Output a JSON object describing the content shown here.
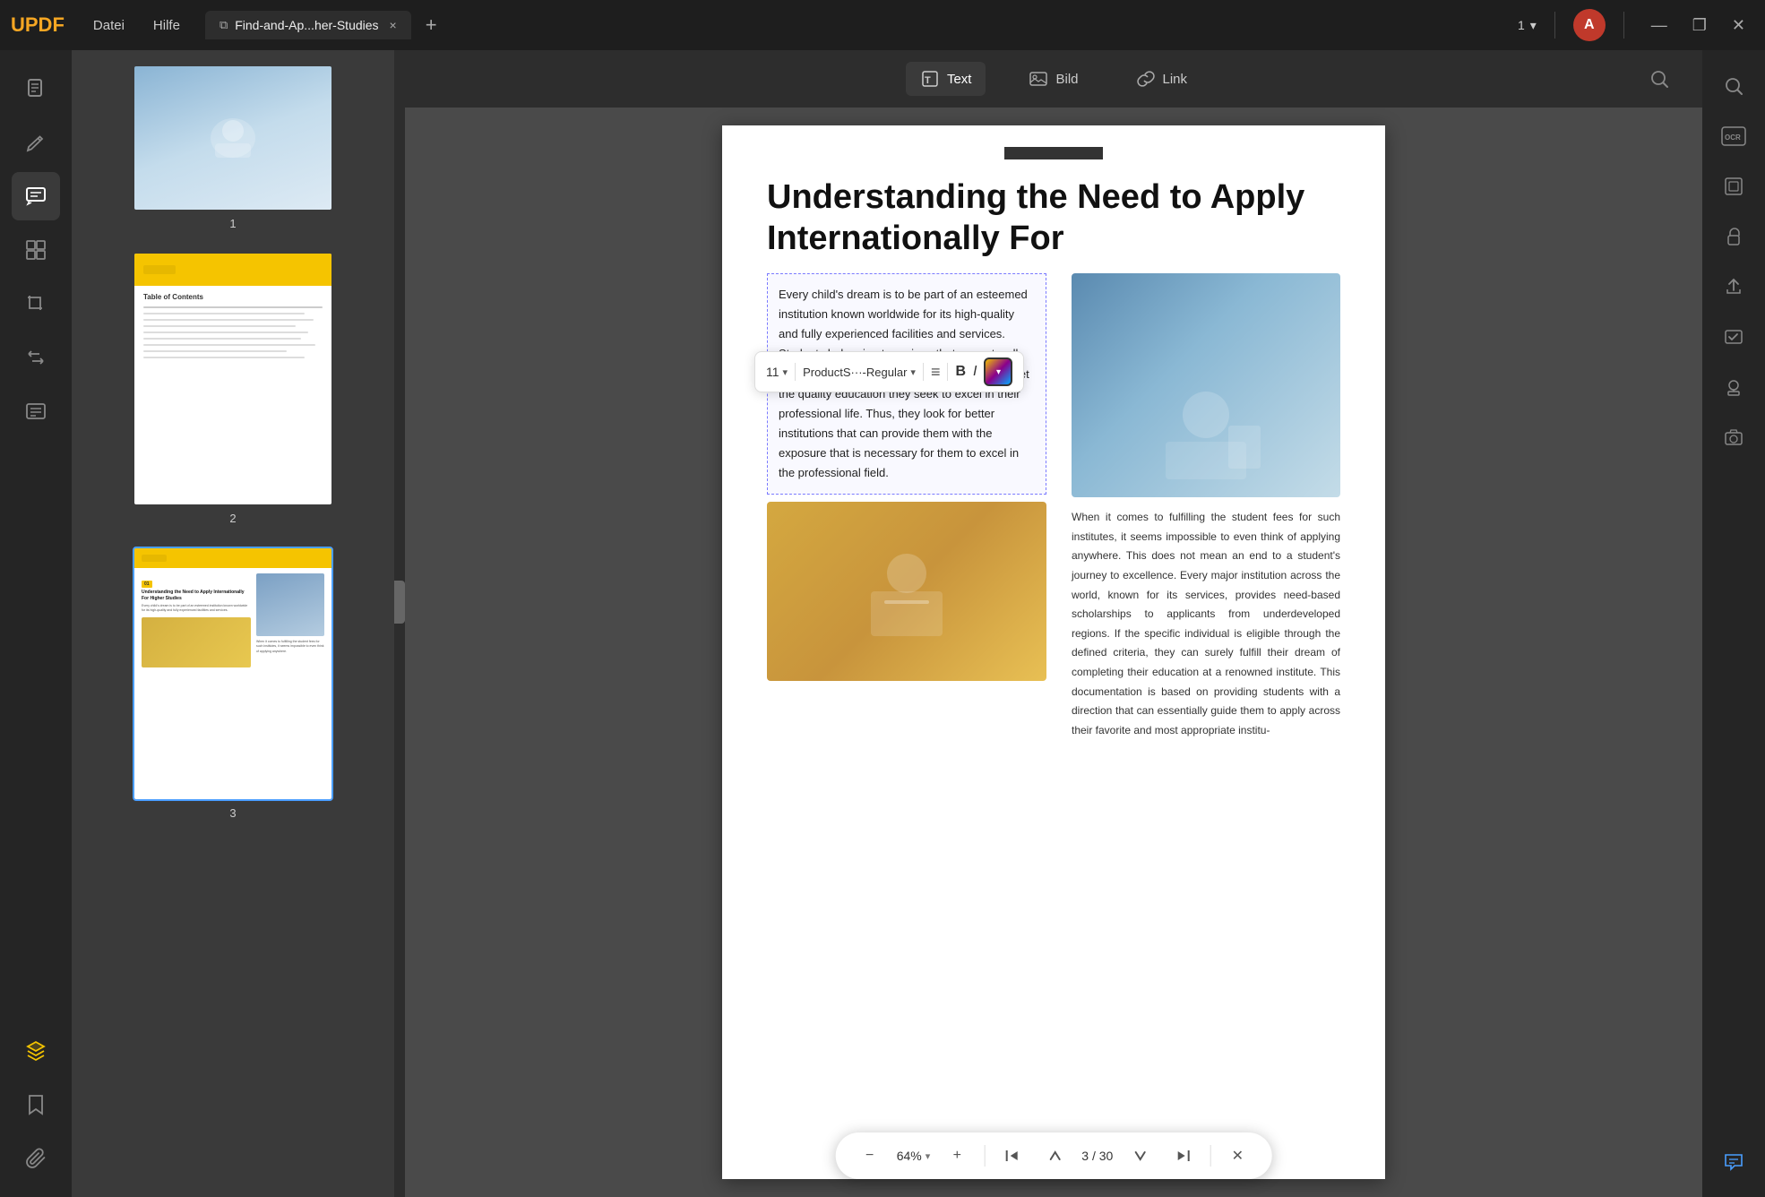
{
  "app": {
    "logo": "UPDF",
    "menu": {
      "datei": "Datei",
      "hilfe": "Hilfe"
    }
  },
  "titlebar": {
    "tab": {
      "icon": "📄",
      "label": "Find-and-Ap...her-Studies",
      "close": "×"
    },
    "add_tab": "+",
    "page_nav": {
      "current": "1",
      "chevron": "▾"
    },
    "avatar_letter": "A",
    "win_buttons": {
      "minimize": "—",
      "maximize": "❐",
      "close": "✕"
    }
  },
  "sidebar": {
    "icons": [
      {
        "name": "document-icon",
        "symbol": "📋",
        "active": false
      },
      {
        "name": "edit-icon",
        "symbol": "✏️",
        "active": false
      },
      {
        "name": "comment-icon",
        "symbol": "🗂",
        "active": true
      },
      {
        "name": "organize-icon",
        "symbol": "📑",
        "active": false
      },
      {
        "name": "crop-icon",
        "symbol": "⊞",
        "active": false
      },
      {
        "name": "convert-icon",
        "symbol": "🔄",
        "active": false
      },
      {
        "name": "ocr-icon",
        "symbol": "≡",
        "active": false
      }
    ],
    "bottom": [
      {
        "name": "layers-icon",
        "symbol": "◈"
      },
      {
        "name": "bookmark-icon",
        "symbol": "🔖"
      },
      {
        "name": "paperclip-icon",
        "symbol": "📎"
      }
    ]
  },
  "thumbnails": [
    {
      "id": 1,
      "label": "1",
      "selected": false
    },
    {
      "id": 2,
      "label": "2",
      "selected": false,
      "title": "Table of Contents"
    },
    {
      "id": 3,
      "label": "3",
      "selected": true
    }
  ],
  "toolbar": {
    "text_btn": "Text",
    "bild_btn": "Bild",
    "link_btn": "Link"
  },
  "format_toolbar": {
    "size": "11",
    "size_arrow": "▾",
    "font": "ProductS···-Regular",
    "font_arrow": "▾",
    "align_icon": "≡",
    "bold": "B",
    "italic": "I"
  },
  "document": {
    "title": "Understanding the Need to Apply Internationally For",
    "paragraph1": "Every child's dream is to be part of an esteemed institution known worldwide for its high-quality and fully experienced facilities and services. Students belonging to regions that are not well-esteemed and underdeveloped usually fail to get the quality education they seek to excel in their professional life. Thus, they look for better institutions that can provide them with the exposure that is necessary for them to excel in the professional field.",
    "paragraph2": "When it comes to fulfilling the student fees for such institutes, it seems impossible to even think of applying anywhere. This does not mean an end to a student's journey to excellence. Every major institution across the world, known for its services, provides need-based scholarships to applicants from underdeveloped regions. If the specific individual is eligible through the defined criteria, they can surely fulfill their dream of completing their education at a renowned institute. This documentation is based on providing students with a direction that can essentially guide them to apply across their favorite and most appropriate institu-"
  },
  "bottom_bar": {
    "zoom_out": "−",
    "zoom_level": "64%",
    "zoom_arrow": "▾",
    "zoom_in": "+",
    "nav_first": "⇤",
    "nav_prev": "↑",
    "nav_next": "↓",
    "nav_last": "⇥",
    "page_current": "3",
    "page_separator": "/",
    "page_total": "30",
    "close": "✕"
  },
  "right_sidebar": {
    "icons": [
      {
        "name": "search-icon",
        "symbol": "🔍"
      },
      {
        "name": "ocr-right-icon",
        "symbol": "OCR"
      },
      {
        "name": "scan-icon",
        "symbol": "⊡"
      },
      {
        "name": "lock-icon",
        "symbol": "🔒"
      },
      {
        "name": "share-icon",
        "symbol": "⬆"
      },
      {
        "name": "check-icon",
        "symbol": "✓"
      },
      {
        "name": "stamp-icon",
        "symbol": "⊕"
      },
      {
        "name": "camera-icon",
        "symbol": "◎"
      }
    ]
  }
}
